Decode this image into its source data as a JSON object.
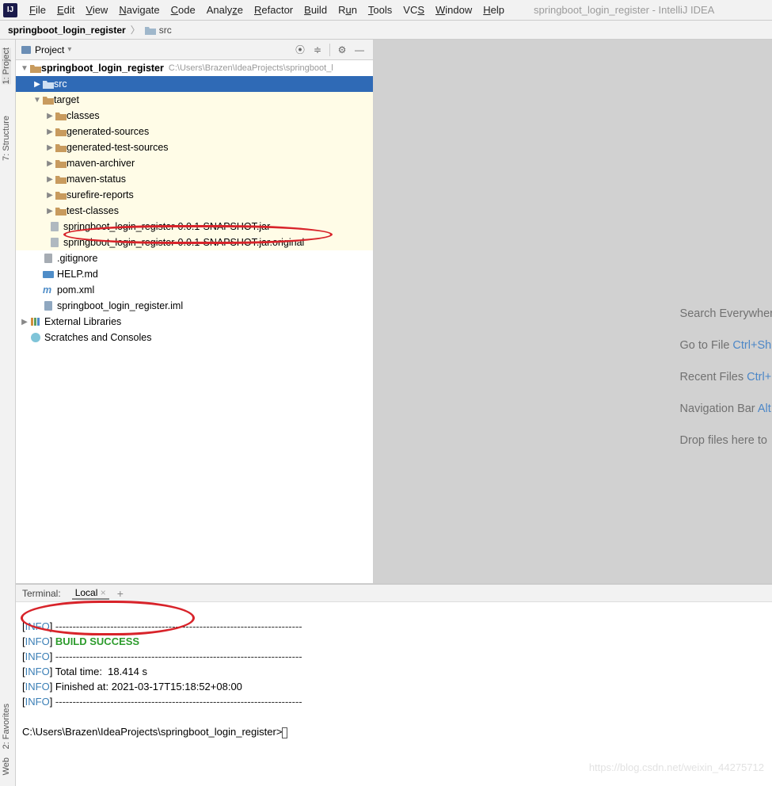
{
  "window": {
    "title": "springboot_login_register - IntelliJ IDEA"
  },
  "menu": {
    "items": [
      "File",
      "Edit",
      "View",
      "Navigate",
      "Code",
      "Analyze",
      "Refactor",
      "Build",
      "Run",
      "Tools",
      "VCS",
      "Window",
      "Help"
    ]
  },
  "breadcrumb": {
    "root": "springboot_login_register",
    "child": "src"
  },
  "left_toolstrip": {
    "project": "1: Project",
    "structure": "7: Structure",
    "favorites": "2: Favorites",
    "web": "Web"
  },
  "project_panel": {
    "header_label": "Project",
    "root_name": "springboot_login_register",
    "root_path": "C:\\Users\\Brazen\\IdeaProjects\\springboot_l",
    "src": "src",
    "target": "target",
    "target_children": [
      "classes",
      "generated-sources",
      "generated-test-sources",
      "maven-archiver",
      "maven-status",
      "surefire-reports",
      "test-classes"
    ],
    "jar": "springboot_login_register-0.0.1-SNAPSHOT.jar",
    "jar_orig": "springboot_login_register-0.0.1-SNAPSHOT.jar.original",
    "files": {
      "gitignore": ".gitignore",
      "help": "HELP.md",
      "pom": "pom.xml",
      "iml": "springboot_login_register.iml"
    },
    "ext_libs": "External Libraries",
    "scratches": "Scratches and Consoles"
  },
  "editor_hints": {
    "search": "Search Everywher",
    "goto_label": "Go to File ",
    "goto_key": "Ctrl+Sh",
    "recent_label": "Recent Files ",
    "recent_key": "Ctrl+",
    "nav_label": "Navigation Bar ",
    "nav_key": "Alt",
    "drop": "Drop files here to"
  },
  "terminal": {
    "header": "Terminal:",
    "tab": "Local",
    "lines": {
      "dashes": "------------------------------------------------------------------------",
      "build_success": "BUILD SUCCESS",
      "total_time": "Total time:  18.414 s",
      "finished": "Finished at: 2021-03-17T15:18:52+08:00",
      "prompt": "C:\\Users\\Brazen\\IdeaProjects\\springboot_login_register>"
    }
  },
  "watermark": "https://blog.csdn.net/weixin_44275712"
}
